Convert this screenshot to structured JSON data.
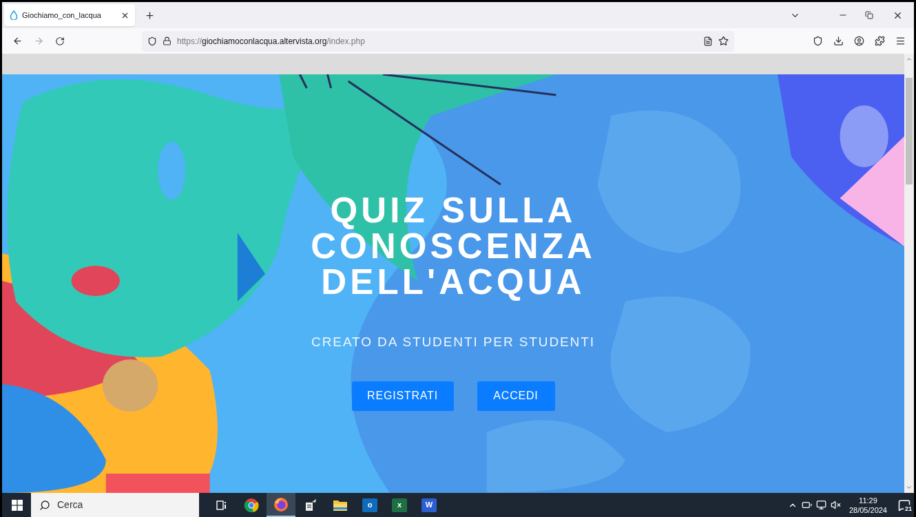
{
  "browser": {
    "tab": {
      "title": "Giochiamo_con_lacqua",
      "selected": true
    },
    "url": {
      "scheme": "https://",
      "host": "giochiamoconlacqua.altervista.org",
      "path": "/index.php"
    }
  },
  "hero": {
    "title": "QUIZ SULLA CONOSCENZA DELL'ACQUA",
    "subtitle": "CREATO DA STUDENTI PER STUDENTI",
    "buttons": [
      "REGISTRATI",
      "ACCEDI"
    ]
  },
  "taskbar": {
    "search": {
      "placeholder": "Cerca"
    },
    "apps": [
      {
        "kind": "taskview",
        "selected": false
      },
      {
        "kind": "chrome",
        "selected": false
      },
      {
        "kind": "firefox",
        "selected": true
      },
      {
        "kind": "tool",
        "selected": false
      },
      {
        "kind": "folder",
        "selected": false
      },
      {
        "kind": "office",
        "letter": "o",
        "color": "#0f6cbd",
        "selected": false
      },
      {
        "kind": "office",
        "letter": "x",
        "color": "#1d7044",
        "selected": false
      },
      {
        "kind": "office",
        "letter": "W",
        "color": "#2b5fd0",
        "selected": false
      }
    ],
    "time": "11:29",
    "date": "28/05/2024",
    "notifications": "21"
  }
}
